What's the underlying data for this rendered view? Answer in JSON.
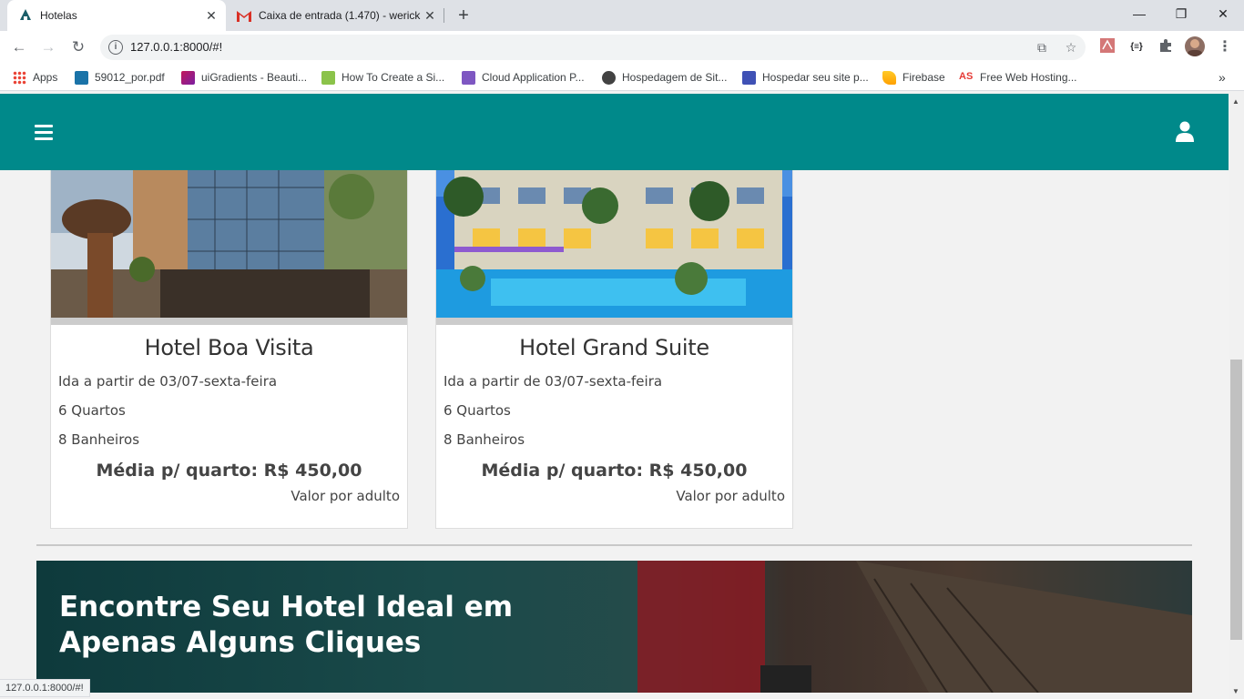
{
  "browser": {
    "tabs": [
      {
        "title": "Hotelas",
        "active": true
      },
      {
        "title": "Caixa de entrada (1.470) - werick",
        "active": false
      }
    ],
    "new_tab": "+",
    "window_controls": {
      "minimize": "—",
      "restore": "❐",
      "close": "✕"
    },
    "url": "127.0.0.1:8000/#!",
    "bookmarks": [
      {
        "label": "Apps",
        "color": "#4285f4"
      },
      {
        "label": "59012_por.pdf",
        "color": "#1a73a8"
      },
      {
        "label": "uiGradients - Beauti...",
        "color": "#c2185b"
      },
      {
        "label": "How To Create a Si...",
        "color": "#8bc34a"
      },
      {
        "label": "Cloud Application P...",
        "color": "#7e57c2"
      },
      {
        "label": "Hospedagem de Sit...",
        "color": "#424242"
      },
      {
        "label": "Hospedar seu site p...",
        "color": "#3f51b5"
      },
      {
        "label": "Firebase",
        "color": "#ffa000"
      },
      {
        "label": "Free Web Hosting...",
        "color": "#e53935"
      }
    ],
    "bookmarks_overflow": "»",
    "status_url": "127.0.0.1:8000/#!"
  },
  "header": {
    "bg_color": "#00898a"
  },
  "hotels": [
    {
      "name": "Hotel Boa Visita",
      "departure": "Ida a partir de 03/07-sexta-feira",
      "rooms": "6 Quartos",
      "bathrooms": "8 Banheiros",
      "price": "Média p/ quarto: R$ 450,00",
      "note": "Valor por adulto"
    },
    {
      "name": "Hotel Grand Suite",
      "departure": "Ida a partir de 03/07-sexta-feira",
      "rooms": "6 Quartos",
      "bathrooms": "8 Banheiros",
      "price": "Média p/ quarto: R$ 450,00",
      "note": "Valor por adulto"
    }
  ],
  "banner": {
    "line1": "Encontre Seu Hotel Ideal em",
    "line2": "Apenas Alguns Cliques"
  }
}
